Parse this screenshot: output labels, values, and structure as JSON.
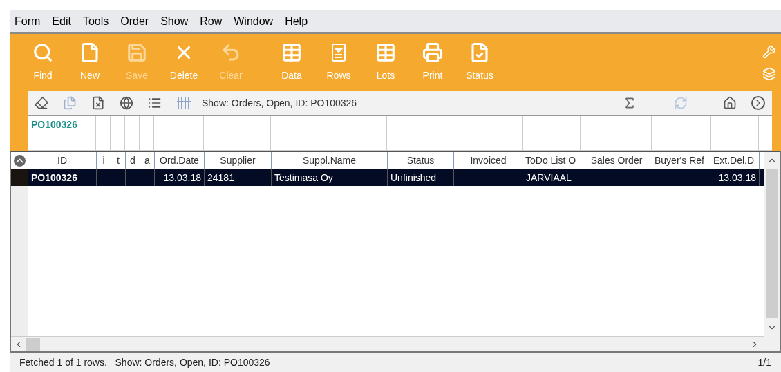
{
  "menu": [
    {
      "label": "Form"
    },
    {
      "label": "Edit"
    },
    {
      "label": "Tools"
    },
    {
      "label": "Order"
    },
    {
      "label": "Show"
    },
    {
      "label": "Row"
    },
    {
      "label": "Window"
    },
    {
      "label": "Help"
    }
  ],
  "toolbar": [
    {
      "label": "Find",
      "disabled": false
    },
    {
      "label": "New",
      "disabled": false
    },
    {
      "label": "Save",
      "disabled": true
    },
    {
      "label": "Delete",
      "disabled": false
    },
    {
      "label": "Clear",
      "disabled": true
    },
    {
      "label": "Data",
      "disabled": false
    },
    {
      "label": "Rows",
      "disabled": false
    },
    {
      "label": "Lots",
      "disabled": false
    },
    {
      "label": "Print",
      "disabled": false
    },
    {
      "label": "Status",
      "disabled": false
    }
  ],
  "sub_toolbar": {
    "filter_text": "Show: Orders, Open, ID: PO100326"
  },
  "filter_row": {
    "id": "PO100326"
  },
  "table": {
    "columns": [
      "ID",
      "i",
      "t",
      "d",
      "a",
      "Ord.Date",
      "Supplier",
      "Suppl.Name",
      "Status",
      "Invoiced",
      "ToDo List O",
      "Sales Order",
      "Buyer's Ref",
      "Ext.Del.D"
    ],
    "rows": [
      {
        "selected": true,
        "cells": [
          "PO100326",
          "",
          "",
          "",
          "",
          "13.03.18",
          "24181",
          "Testimasa Oy",
          "Unfinished",
          "",
          "JARVIAAL",
          "",
          "",
          "13.03.18"
        ]
      }
    ]
  },
  "status_bar": {
    "text": "Fetched 1 of 1 rows.   Show: Orders, Open, ID: PO100326",
    "page": "1/1"
  }
}
